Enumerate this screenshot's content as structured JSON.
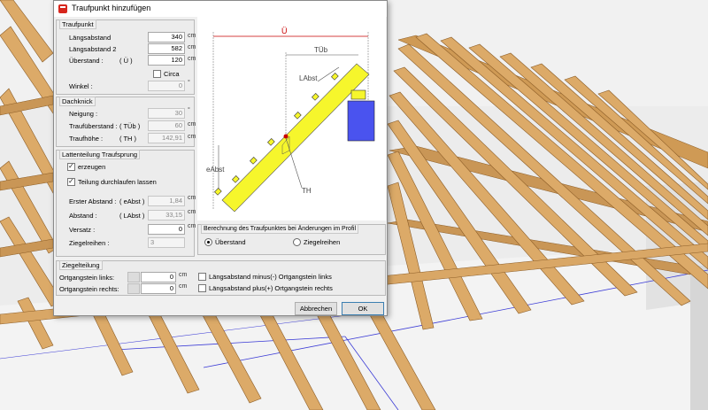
{
  "window": {
    "title": "Traufpunkt hinzufügen",
    "minimize": "─",
    "maximize": "☐",
    "close": "✕"
  },
  "traufpunkt": {
    "title": "Traufpunkt",
    "laengsabstand": {
      "label": "Längsabstand",
      "value": "340",
      "unit": "cm"
    },
    "laengsabstand2": {
      "label": "Längsabstand 2",
      "value": "582",
      "unit": "cm"
    },
    "ueberstand": {
      "label": "Überstand :",
      "symbol": "( Ü )",
      "value": "120",
      "unit": "cm"
    },
    "circa": {
      "label": "Circa"
    },
    "winkel": {
      "label": "Winkel :",
      "value": "0",
      "unit": "°"
    }
  },
  "dachknick": {
    "title": "Dachknick",
    "neigung": {
      "label": "Neigung :",
      "value": "30",
      "unit": "°"
    },
    "traufueberstand": {
      "label": "Traufüberstand :",
      "symbol": "( TÜb )",
      "value": "60",
      "unit": "cm"
    },
    "traufhoehe": {
      "label": "Traufhöhe :",
      "symbol": "( TH )",
      "value": "142,91",
      "unit": "cm"
    }
  },
  "lattenteilung": {
    "title": "Lattenteilung Traufsprung",
    "erzeugen": {
      "label": "erzeugen"
    },
    "teilung": {
      "label": "Teilung durchlaufen lassen"
    },
    "erster_abstand": {
      "label": "Erster Abstand :",
      "symbol": "( eAbst )",
      "value": "1,84",
      "unit": "cm"
    },
    "abstand": {
      "label": "Abstand :",
      "symbol": "( LAbst )",
      "value": "33,15",
      "unit": "cm"
    },
    "versatz": {
      "label": "Versatz :",
      "value": "0",
      "unit": "cm"
    },
    "ziegelreihen": {
      "label": "Ziegelreihen :",
      "value": "3"
    }
  },
  "diagram_labels": {
    "u": "Ü",
    "tub": "TÜb",
    "labst": "LAbst",
    "eabst": "eAbst",
    "th": "TH"
  },
  "berechnung": {
    "title": "Berechnung des Traufpunktes bei Änderungen im Profil",
    "option1": "Überstand",
    "option2": "Ziegelreihen"
  },
  "ziegelteilung": {
    "title": "Ziegelteilung",
    "ortganglinks": {
      "label": "Ortgangstein links:",
      "value": "0",
      "unit": "cm"
    },
    "ortgangrechts": {
      "label": "Ortgangstein rechts:",
      "value": "0",
      "unit": "cm"
    },
    "minus_links": "Längsabstand minus(-) Ortgangstein links",
    "plus_rechts": "Längsabstand plus(+)  Ortgangstein rechts"
  },
  "buttons": {
    "cancel": "Abbrechen",
    "ok": "OK"
  },
  "colors": {
    "timber": "#d8a765",
    "timber_dark": "#a86f30",
    "diagram_yellow": "#f6f62c",
    "diagram_blue": "#4a53ef",
    "diagram_red": "#c90000"
  }
}
